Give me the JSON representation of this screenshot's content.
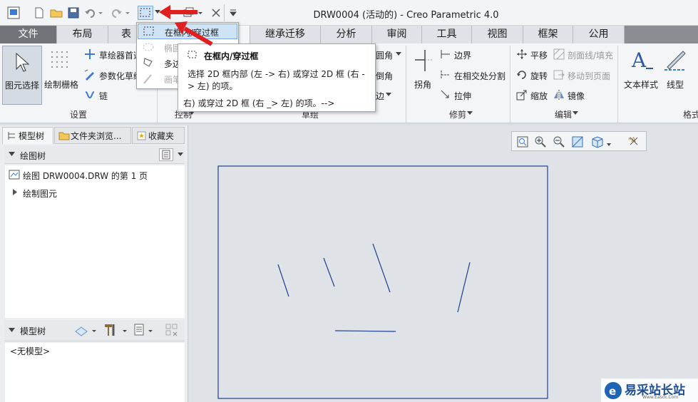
{
  "app": {
    "title": "DRW0004 (活动的) - Creo Parametric 4.0"
  },
  "tabs": [
    "文件",
    "布局",
    "表",
    "",
    "继承迁移",
    "分析",
    "审阅",
    "工具",
    "视图",
    "框架",
    "公用"
  ],
  "ribbon": {
    "select_label": "图元选择",
    "grid_label": "绘制栅格",
    "sketch_pref": "草绘器首选",
    "param_sketch": "参数化草绘",
    "chain": "链",
    "group_settings": "设置",
    "group_control": "控制",
    "group_sketch": "草绘",
    "multi_prefix": "多边",
    "rect_prefix": "椭圆",
    "paint_prefix": "画笔",
    "fillet": "圆角",
    "chamfer": "倒角",
    "offset_edge": "边",
    "corner": "拐角",
    "boundary": "边界",
    "split": "在相交处分割",
    "stretch": "拉伸",
    "group_trim": "修剪",
    "translate": "平移",
    "hatch": "剖面线/填充",
    "rotate": "旋转",
    "move_to_page": "移动到页面",
    "scale": "缩放",
    "mirror": "镜像",
    "group_edit": "编辑",
    "text_style": "文本样式",
    "line_style": "线型",
    "group_format": "格式"
  },
  "dropdown": {
    "items": [
      "在框内/穿过框",
      "椭圆",
      "多边",
      "画笔"
    ]
  },
  "tooltip": {
    "title": "在框内/穿过框",
    "line1": "选择 2D 框内部 (左 -> 右) 或穿过 2D 框 (右 -",
    "line2": "> 左) 的项。",
    "line3": "右) 或穿过 2D 框 (右 _> 左) 的项。-->"
  },
  "panel": {
    "tab_model_tree": "模型树",
    "tab_folder": "文件夹浏览...",
    "tab_fav": "收藏夹",
    "drawing_tree": "绘图树",
    "drawing_item": "绘图 DRW0004.DRW 的第 1 页",
    "draw_elements": "绘制图元",
    "model_tree": "模型树",
    "no_model": "<无模型>"
  },
  "watermark": {
    "text": "易采站长站",
    "sub": "Www.Easck.Com"
  }
}
